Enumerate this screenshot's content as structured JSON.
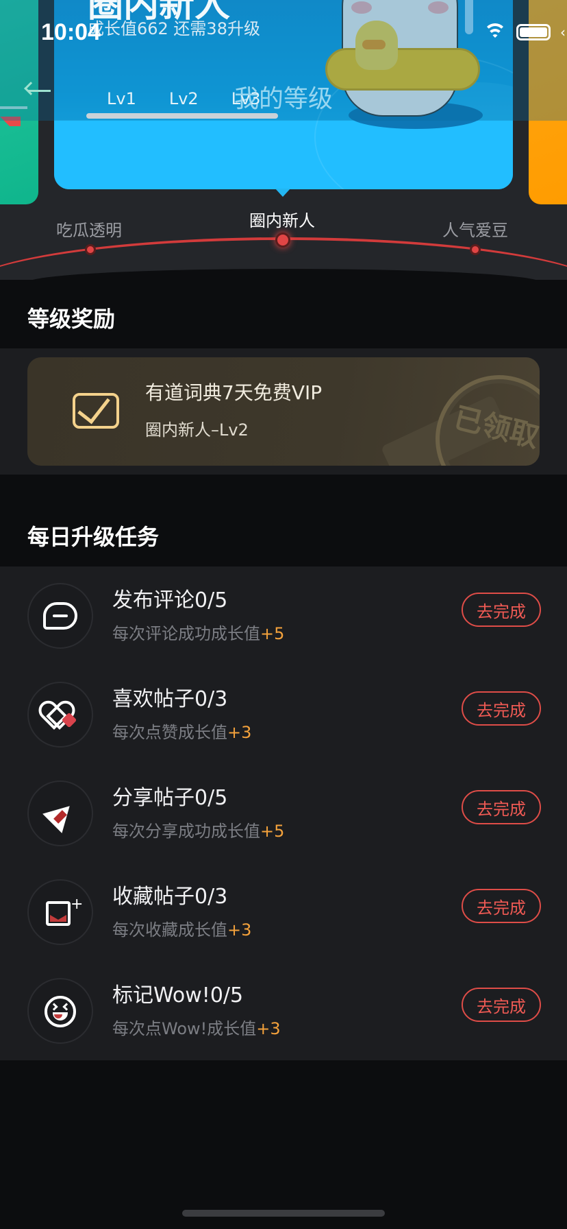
{
  "status_bar": {
    "time": "10:04",
    "edge_glyph": "‹"
  },
  "header": {
    "level_title": "圈内新人",
    "growth_text": "成长值662 还需38升级",
    "page_title": "我的等级",
    "lv_labels": [
      "Lv1",
      "Lv2",
      "Lv3"
    ]
  },
  "level_track": {
    "left": "吃瓜透明",
    "current": "圈内新人",
    "right": "人气爱豆"
  },
  "rewards": {
    "section_title": "等级奖励",
    "card": {
      "title": "有道词典7天免费VIP",
      "subtitle": "圈内新人–Lv2",
      "stamp": "已领取"
    }
  },
  "tasks": {
    "section_title": "每日升级任务",
    "button_label": "去完成",
    "items": [
      {
        "icon": "comment-icon",
        "name": "发布评论0/5",
        "desc": "每次评论成功成长值",
        "bonus": "+5"
      },
      {
        "icon": "heart-icon",
        "name": "喜欢帖子0/3",
        "desc": "每次点赞成长值",
        "bonus": "+3"
      },
      {
        "icon": "share-icon",
        "name": "分享帖子0/5",
        "desc": "每次分享成功成长值",
        "bonus": "+5"
      },
      {
        "icon": "bookmark-icon",
        "name": "收藏帖子0/3",
        "desc": "每次收藏成长值",
        "bonus": "+3"
      },
      {
        "icon": "wow-icon",
        "name": "标记Wow!0/5",
        "desc": "每次点Wow!成长值",
        "bonus": "+3"
      }
    ]
  },
  "colors": {
    "accent_red": "#df4d48",
    "bonus_orange": "#f4a23c",
    "gold": "#f4d28c"
  }
}
